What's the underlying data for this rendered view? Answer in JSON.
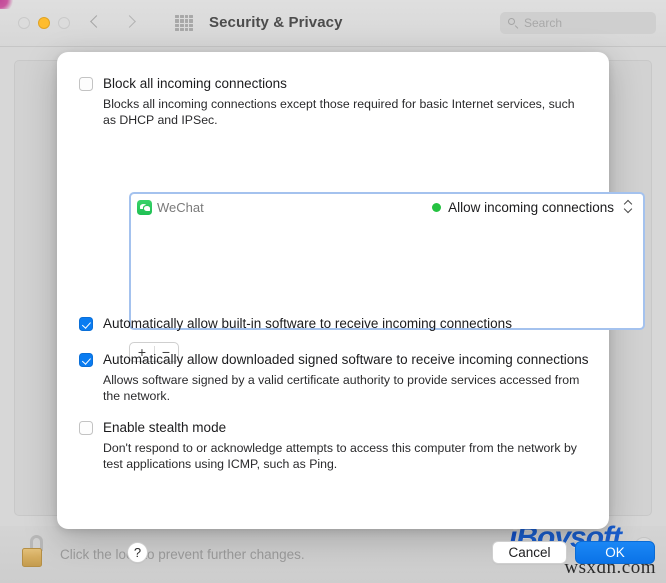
{
  "window": {
    "title": "Security & Privacy",
    "traffic_lights": [
      "close",
      "minimize",
      "zoom"
    ],
    "nav_back": "back-chevron",
    "nav_forward": "forward-chevron",
    "show_all_icon": "grid-icon",
    "search": {
      "placeholder": "Search",
      "icon": "search-icon",
      "value": ""
    }
  },
  "sheet": {
    "block_all": {
      "label": "Block all incoming connections",
      "checked": false,
      "description": "Blocks all incoming connections except those required for basic Internet services, such as DHCP and IPSec."
    },
    "app_list": {
      "items": [
        {
          "name": "WeChat",
          "icon": "wechat-icon",
          "status": "Allow incoming connections",
          "status_color": "#25c241",
          "stepper": "up-down-chevron-icon"
        }
      ]
    },
    "list_controls": {
      "add_label": "+",
      "remove_label": "−"
    },
    "auto_builtin": {
      "label": "Automatically allow built-in software to receive incoming connections",
      "checked": true
    },
    "auto_signed": {
      "label": "Automatically allow downloaded signed software to receive incoming connections",
      "checked": true,
      "description": "Allows software signed by a valid certificate authority to provide services accessed from the network."
    },
    "stealth": {
      "label": "Enable stealth mode",
      "checked": false,
      "description": "Don't respond to or acknowledge attempts to access this computer from the network by test applications using ICMP, such as Ping."
    },
    "footer": {
      "help_label": "?",
      "cancel_label": "Cancel",
      "ok_label": "OK"
    }
  },
  "lock_bar": {
    "icon": "unlocked-padlock-icon",
    "text": "Click the lock to prevent further changes.",
    "help_label": "?"
  },
  "watermark": {
    "brand_i": "i",
    "brand_rest": "Boysoft",
    "site": "wsxdn.com"
  },
  "colors": {
    "accent_blue": "#0a73e8",
    "status_green": "#25c241",
    "focus_ring": "#a4c2ee",
    "amber_light": "#febc2e",
    "brand_blue": "#1a5fd0"
  }
}
